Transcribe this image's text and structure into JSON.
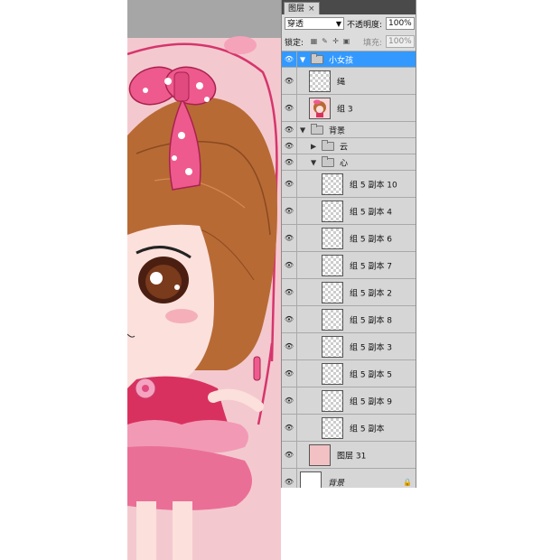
{
  "panel": {
    "tab_label": "图层",
    "tab_close": "×",
    "blend_mode": "穿透",
    "opacity_label": "不透明度:",
    "opacity_value": "100%",
    "lock_label": "锁定:",
    "fill_label": "填充:",
    "fill_value": "100%"
  },
  "layers": [
    {
      "name": "小女孩",
      "type": "group",
      "expanded": true,
      "selected": true,
      "indent": 0
    },
    {
      "name": "绳",
      "type": "layer",
      "thumb": "transparent",
      "indent": 1
    },
    {
      "name": "组 3",
      "type": "layer",
      "thumb": "girl",
      "indent": 1
    },
    {
      "name": "背景",
      "type": "group",
      "expanded": true,
      "indent": 0
    },
    {
      "name": "云",
      "type": "group",
      "expanded": false,
      "indent": 1
    },
    {
      "name": "心",
      "type": "group",
      "expanded": true,
      "indent": 1
    },
    {
      "name": "组 5 副本 10",
      "type": "layer",
      "thumb": "transparent",
      "indent": 2
    },
    {
      "name": "组 5 副本 4",
      "type": "layer",
      "thumb": "transparent",
      "indent": 2
    },
    {
      "name": "组 5 副本 6",
      "type": "layer",
      "thumb": "transparent",
      "indent": 2
    },
    {
      "name": "组 5 副本 7",
      "type": "layer",
      "thumb": "transparent",
      "indent": 2
    },
    {
      "name": "组 5 副本 2",
      "type": "layer",
      "thumb": "transparent",
      "indent": 2
    },
    {
      "name": "组 5 副本 8",
      "type": "layer",
      "thumb": "transparent",
      "indent": 2
    },
    {
      "name": "组 5 副本 3",
      "type": "layer",
      "thumb": "transparent",
      "indent": 2
    },
    {
      "name": "组 5 副本 5",
      "type": "layer",
      "thumb": "transparent",
      "indent": 2
    },
    {
      "name": "组 5 副本 9",
      "type": "layer",
      "thumb": "transparent",
      "indent": 2
    },
    {
      "name": "组 5 副本",
      "type": "layer",
      "thumb": "transparent",
      "indent": 2
    },
    {
      "name": "图层 31",
      "type": "layer",
      "thumb": "pink",
      "indent": 1
    },
    {
      "name": "背景",
      "type": "background",
      "thumb": "white",
      "indent": 0,
      "locked": true
    }
  ],
  "colors": {
    "canvas_bg": "#f3c9cf",
    "hair": "#b86a35",
    "bow": "#ee5a8e",
    "dress": "#d9315f",
    "selected_row": "#3399ff"
  }
}
